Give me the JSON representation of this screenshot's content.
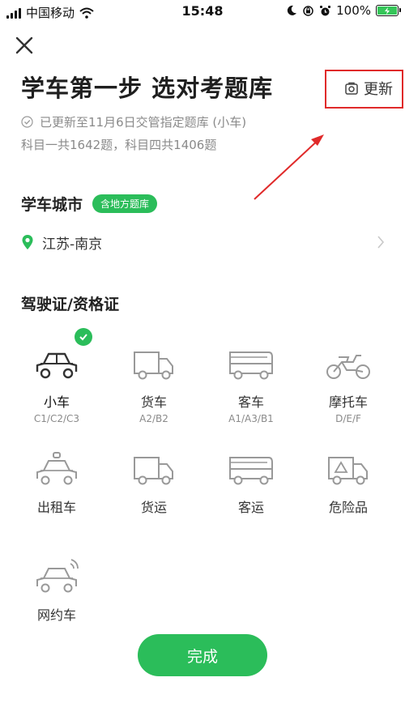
{
  "status_bar": {
    "carrier": "中国移动",
    "time": "15:48",
    "battery": "100%",
    "icons": [
      "signal-icon",
      "wifi-icon",
      "moon-icon",
      "orientation-lock-icon",
      "alarm-icon",
      "battery-charging-icon"
    ]
  },
  "header": {
    "close_icon": "close-icon",
    "title": "学车第一步 选对考题库",
    "update_label": "更新",
    "update_icon": "refresh-icon",
    "subtitle_line1": "已更新至11月6日交管指定题库 (小车)",
    "subtitle_line2": "科目一共1642题，科目四共1406题",
    "highlight_color": "#e02a2a"
  },
  "city": {
    "section_title": "学车城市",
    "badge": "含地方题库",
    "location": "江苏-南京",
    "location_icon": "location-pin-icon"
  },
  "license": {
    "section_title": "驾驶证/资格证",
    "items": [
      {
        "name": "小车",
        "code": "C1/C2/C3",
        "icon": "car-icon",
        "selected": true
      },
      {
        "name": "货车",
        "code": "A2/B2",
        "icon": "truck-icon",
        "selected": false
      },
      {
        "name": "客车",
        "code": "A1/A3/B1",
        "icon": "bus-icon",
        "selected": false
      },
      {
        "name": "摩托车",
        "code": "D/E/F",
        "icon": "motorcycle-icon",
        "selected": false
      },
      {
        "name": "出租车",
        "code": "",
        "icon": "taxi-icon",
        "selected": false
      },
      {
        "name": "货运",
        "code": "",
        "icon": "freight-truck-icon",
        "selected": false
      },
      {
        "name": "客运",
        "code": "",
        "icon": "passenger-bus-icon",
        "selected": false
      },
      {
        "name": "危险品",
        "code": "",
        "icon": "hazmat-truck-icon",
        "selected": false
      },
      {
        "name": "网约车",
        "code": "",
        "icon": "ride-hailing-car-icon",
        "selected": false
      }
    ]
  },
  "done_button": "完成",
  "colors": {
    "accent": "#2bbd5a",
    "text": "#222222",
    "muted": "#8a8a8a",
    "icon": "#8f8f8f"
  }
}
